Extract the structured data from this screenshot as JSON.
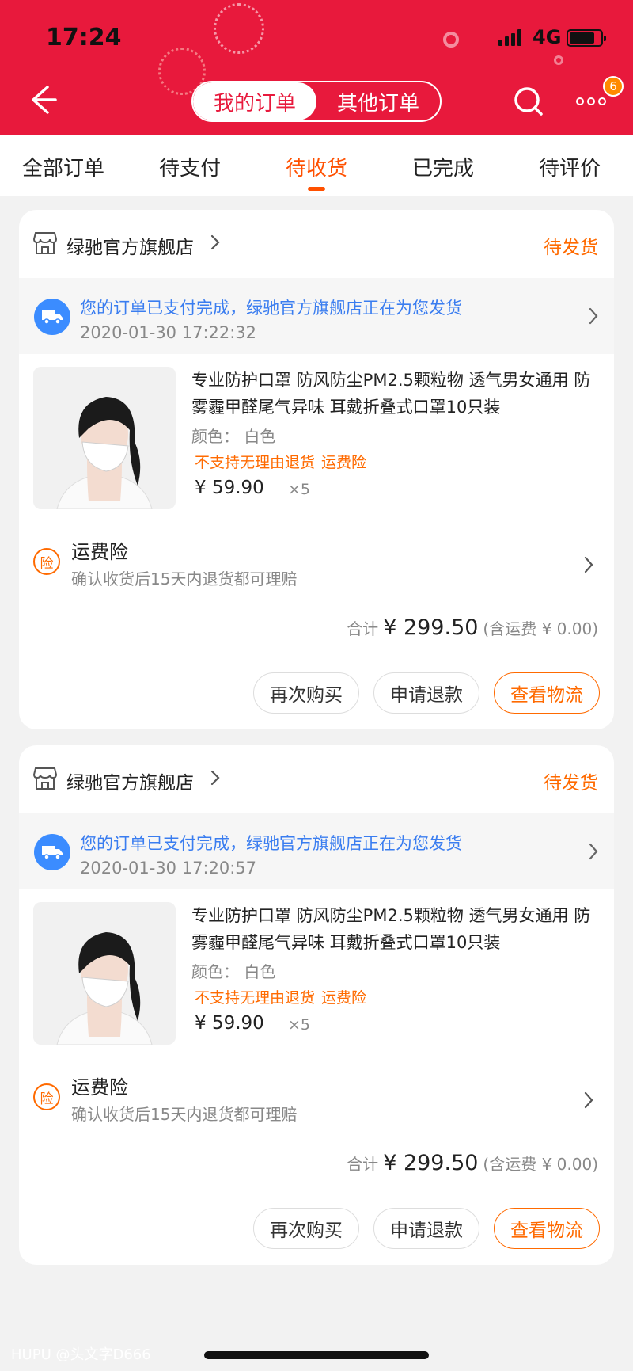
{
  "status_bar": {
    "time": "17:24",
    "network": "4G"
  },
  "nav": {
    "segments": [
      "我的订单",
      "其他订单"
    ],
    "badge_count": "6"
  },
  "tabs": [
    "全部订单",
    "待支付",
    "待收货",
    "已完成",
    "待评价"
  ],
  "active_tab": "待收货",
  "orders": [
    {
      "shop": "绿驰官方旗舰店",
      "status": "待发货",
      "shipping_message": "您的订单已支付完成，绿驰官方旗舰店正在为您发货",
      "shipping_time": "2020-01-30 17:22:32",
      "product_title": "专业防护口罩 防风防尘PM2.5颗粒物 透气男女通用 防雾霾甲醛尾气异味 耳戴折叠式口罩10只装",
      "color": "颜色： 白色",
      "tags": [
        "不支持无理由退货",
        "运费险"
      ],
      "price": "¥ 59.90",
      "qty": "×5",
      "insurance_icon": "险",
      "insurance_title": "运费险",
      "insurance_sub": "确认收货后15天内退货都可理赔",
      "total_label": "合计",
      "total": "¥ 299.50",
      "shipping_fee": "(含运费 ¥ 0.00)",
      "buttons": [
        "再次购买",
        "申请退款",
        "查看物流"
      ]
    },
    {
      "shop": "绿驰官方旗舰店",
      "status": "待发货",
      "shipping_message": "您的订单已支付完成，绿驰官方旗舰店正在为您发货",
      "shipping_time": "2020-01-30 17:20:57",
      "product_title": "专业防护口罩 防风防尘PM2.5颗粒物 透气男女通用 防雾霾甲醛尾气异味 耳戴折叠式口罩10只装",
      "color": "颜色： 白色",
      "tags": [
        "不支持无理由退货",
        "运费险"
      ],
      "price": "¥ 59.90",
      "qty": "×5",
      "insurance_icon": "险",
      "insurance_title": "运费险",
      "insurance_sub": "确认收货后15天内退货都可理赔",
      "total_label": "合计",
      "total": "¥ 299.50",
      "shipping_fee": "(含运费 ¥ 0.00)",
      "buttons": [
        "再次购买",
        "申请退款",
        "查看物流"
      ]
    }
  ],
  "watermark": "HUPU @头文字D666",
  "colors": {
    "header": "#e8193c",
    "accent": "#ff5000",
    "link": "#3a7df0"
  }
}
